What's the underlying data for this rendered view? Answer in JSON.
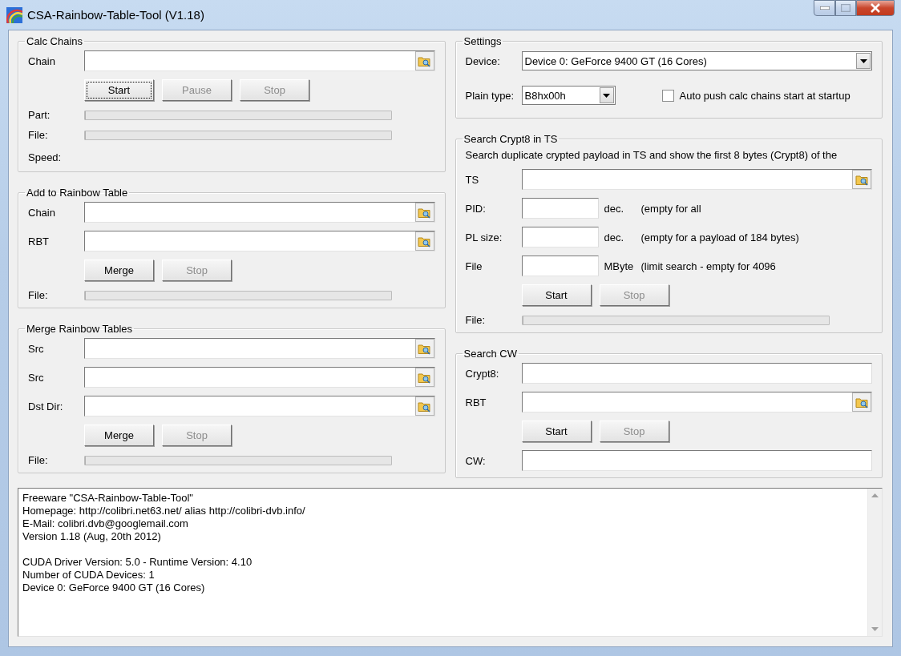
{
  "window": {
    "title": "CSA-Rainbow-Table-Tool (V1.18)"
  },
  "left_groups": [
    {
      "title": "Calc Chains",
      "rows": [
        {
          "kind": "file",
          "label": "Chain"
        },
        {
          "kind": "buttons",
          "buttons": [
            {
              "label": "Start",
              "disabled": false,
              "focused": true
            },
            {
              "label": "Pause",
              "disabled": true,
              "focused": false
            },
            {
              "label": "Stop",
              "disabled": true,
              "focused": false
            }
          ]
        },
        {
          "kind": "progress",
          "label": "Part:",
          "level": 0
        },
        {
          "kind": "progress",
          "label": "File:",
          "level": 0
        },
        {
          "kind": "label",
          "label": "Speed:"
        }
      ]
    },
    {
      "title": "Add to Rainbow Table",
      "rows": [
        {
          "kind": "file",
          "label": "Chain"
        },
        {
          "kind": "file",
          "label": "RBT"
        },
        {
          "kind": "buttons",
          "buttons": [
            {
              "label": "Merge",
              "disabled": false,
              "focused": false
            },
            {
              "label": "Stop",
              "disabled": true,
              "focused": false
            }
          ]
        },
        {
          "kind": "progress",
          "label": "File:",
          "level": 0
        }
      ]
    },
    {
      "title": "Merge Rainbow Tables",
      "rows": [
        {
          "kind": "file",
          "label": "Src"
        },
        {
          "kind": "file",
          "label": "Src"
        },
        {
          "kind": "file",
          "label": "Dst Dir:"
        },
        {
          "kind": "buttons",
          "buttons": [
            {
              "label": "Merge",
              "disabled": false,
              "focused": false
            },
            {
              "label": "Stop",
              "disabled": true,
              "focused": false
            }
          ]
        },
        {
          "kind": "progress",
          "label": "File:",
          "level": 0
        }
      ]
    }
  ],
  "right_groups": [
    {
      "title": "Settings",
      "rows": [
        {
          "kind": "select",
          "label": "Device:",
          "value": "Device 0: GeForce 9400 GT (16 Cores)"
        },
        {
          "kind": "select_check",
          "label": "Plain type:",
          "value": "B8hx00h",
          "check_label": "Auto push calc chains start at startup",
          "checked": false
        }
      ]
    },
    {
      "title": "Search Crypt8 in TS",
      "rows": [
        {
          "kind": "text",
          "text": "Search duplicate crypted payload in TS and show the first 8 bytes (Crypt8) of the"
        },
        {
          "kind": "file",
          "label": "TS"
        },
        {
          "kind": "number",
          "label": "PID:",
          "unit": "dec.",
          "hint": "(empty for all"
        },
        {
          "kind": "number",
          "label": "PL size:",
          "unit": "dec.",
          "hint": "(empty for a payload of 184 bytes)"
        },
        {
          "kind": "number",
          "label": "File",
          "unit": "MByte",
          "hint": "(limit search - empty for 4096"
        },
        {
          "kind": "buttons",
          "buttons": [
            {
              "label": "Start",
              "disabled": false,
              "focused": false
            },
            {
              "label": "Stop",
              "disabled": true,
              "focused": false
            }
          ]
        },
        {
          "kind": "progress",
          "label": "File:",
          "level": 0
        }
      ]
    },
    {
      "title": "Search CW",
      "rows": [
        {
          "kind": "field",
          "label": "Crypt8:"
        },
        {
          "kind": "file",
          "label": "RBT"
        },
        {
          "kind": "buttons",
          "buttons": [
            {
              "label": "Start",
              "disabled": false,
              "focused": false
            },
            {
              "label": "Stop",
              "disabled": true,
              "focused": false
            }
          ]
        },
        {
          "kind": "field",
          "label": "CW:"
        }
      ]
    }
  ],
  "log": {
    "blocks": [
      {
        "lines": [
          "Freeware \"CSA-Rainbow-Table-Tool\"",
          "Homepage: http://colibri.net63.net/ alias http://colibri-dvb.info/",
          "E-Mail: colibri.dvb@googlemail.com",
          "Version 1.18 (Aug, 20th 2012)"
        ]
      },
      {
        "lines": [
          "CUDA Driver Version: 5.0 - Runtime Version: 4.10",
          "Number of CUDA Devices: 1",
          "Device 0: GeForce 9400 GT (16 Cores)"
        ]
      }
    ]
  }
}
